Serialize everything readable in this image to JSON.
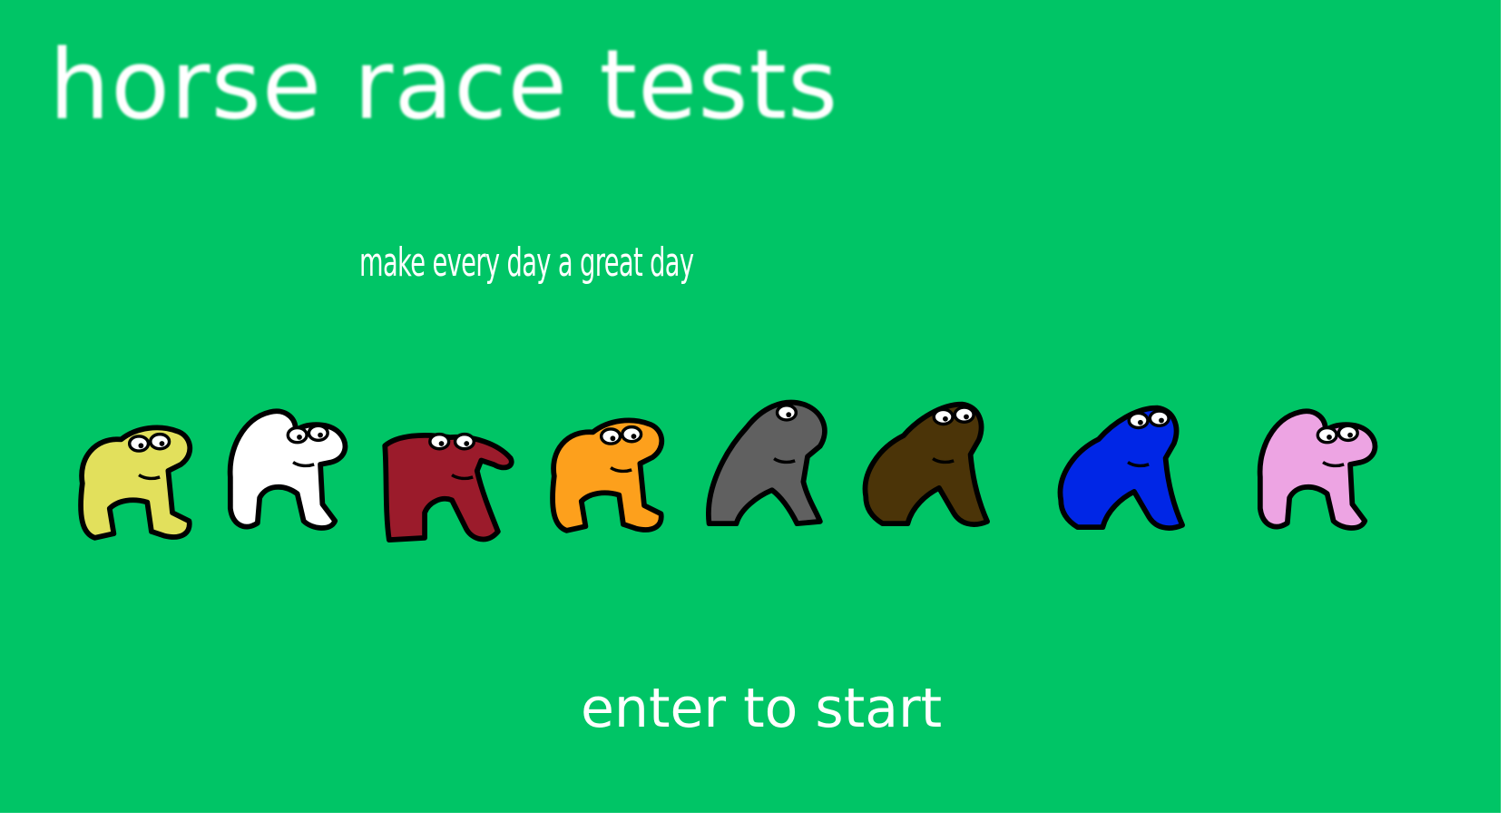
{
  "screen": {
    "title": "horse race tests",
    "tagline": "make every day a great day",
    "start_prompt": "enter to start",
    "background_color": "#00c566",
    "text_color": "#ffffff"
  },
  "horses": [
    {
      "name": "yellow-horse",
      "color": "#e2e05c",
      "pose": "squat"
    },
    {
      "name": "white-horse",
      "color": "#ffffff",
      "pose": "arch"
    },
    {
      "name": "red-horse",
      "color": "#9b1b2b",
      "pose": "lean"
    },
    {
      "name": "orange-horse",
      "color": "#fda01c",
      "pose": "squat"
    },
    {
      "name": "gray-horse",
      "color": "#606060",
      "pose": "tall"
    },
    {
      "name": "brown-horse",
      "color": "#4b3408",
      "pose": "hunch"
    },
    {
      "name": "blue-horse",
      "color": "#0026e6",
      "pose": "hunch"
    },
    {
      "name": "pink-horse",
      "color": "#eda4e3",
      "pose": "arch"
    }
  ]
}
